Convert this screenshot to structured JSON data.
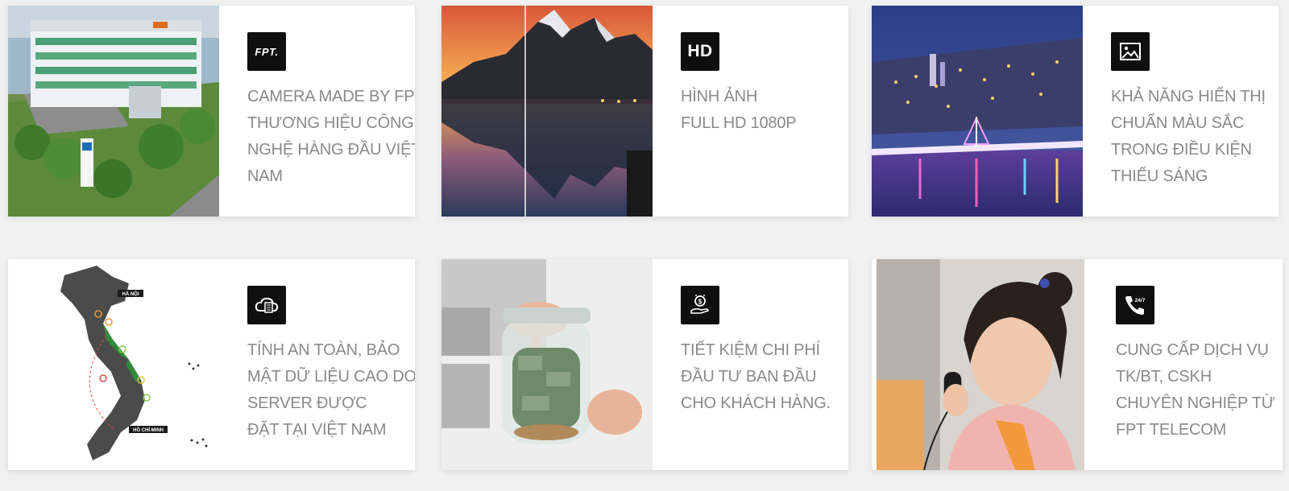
{
  "features": [
    {
      "photo_icon": "fpt-office-building-photo",
      "badge": {
        "icon": "fpt-logo-icon",
        "text": "FPT."
      },
      "lines": [
        "CAMERA MADE BY FPT,",
        "THƯƠNG HIỆU CÔNG",
        "NGHỆ HÀNG ĐẦU VIỆT",
        "NAM"
      ]
    },
    {
      "photo_icon": "mountain-lake-photo",
      "badge": {
        "icon": "hd-icon",
        "text": "HD"
      },
      "lines": [
        "HÌNH ẢNH",
        "FULL HD 1080P"
      ]
    },
    {
      "photo_icon": "night-city-bridge-photo",
      "badge": {
        "icon": "image-icon"
      },
      "lines": [
        "KHẢ NĂNG HIỂN THỊ",
        "CHUẨN MÀU SẮC",
        "TRONG ĐIỀU KIỆN",
        "THIẾU SÁNG"
      ]
    },
    {
      "photo_icon": "vietnam-map-photo",
      "map_labels": [
        "HÀ NỘI",
        "HỒ CHÍ MINH"
      ],
      "badge": {
        "icon": "cloud-server-icon"
      },
      "lines": [
        "TÍNH AN TOÀN, BẢO",
        "MẬT DỮ LIỆU CAO DO",
        "SERVER ĐƯỢC",
        "ĐẶT TẠI VIỆT NAM"
      ]
    },
    {
      "photo_icon": "money-jar-photo",
      "badge": {
        "icon": "money-hand-icon"
      },
      "lines": [
        "TIẾT KIỆM CHI PHÍ",
        "ĐẦU TƯ BAN ĐẦU",
        "CHO KHÁCH HÀNG."
      ]
    },
    {
      "photo_icon": "call-center-woman-photo",
      "badge": {
        "icon": "phone-24-7-icon",
        "text": "24/7"
      },
      "lines": [
        "CUNG CẤP DỊCH VỤ",
        "TK/BT, CSKH",
        "CHUYÊN NGHIỆP TỪ",
        "FPT TELECOM"
      ]
    }
  ]
}
